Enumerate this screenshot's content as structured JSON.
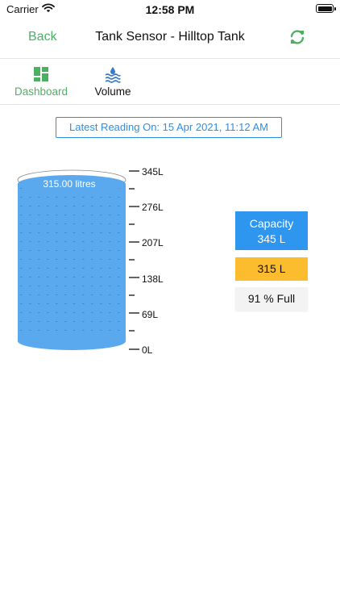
{
  "status_bar": {
    "carrier": "Carrier",
    "time": "12:58 PM"
  },
  "nav": {
    "back_label": "Back",
    "title": "Tank Sensor - Hilltop Tank"
  },
  "tabs": [
    {
      "label": "Dashboard",
      "icon": "dashboard-icon",
      "active": true
    },
    {
      "label": "Volume",
      "icon": "water-level-icon",
      "active": false
    }
  ],
  "reading": {
    "text": "Latest Reading On: 15 Apr 2021, 11:12 AM"
  },
  "tank": {
    "level_label": "315.00 litres",
    "fill_fraction": 0.913,
    "scale_labels": [
      "345L",
      "276L",
      "207L",
      "138L",
      "69L",
      "0L"
    ]
  },
  "capacity": {
    "title": "Capacity",
    "value": "345 L"
  },
  "current_volume": "315 L",
  "percent_full": "91 % Full",
  "colors": {
    "accent_green": "#4caf62",
    "accent_blue": "#2f96ef",
    "water": "#5aa9ee",
    "warning_yellow": "#fbbd2d"
  }
}
